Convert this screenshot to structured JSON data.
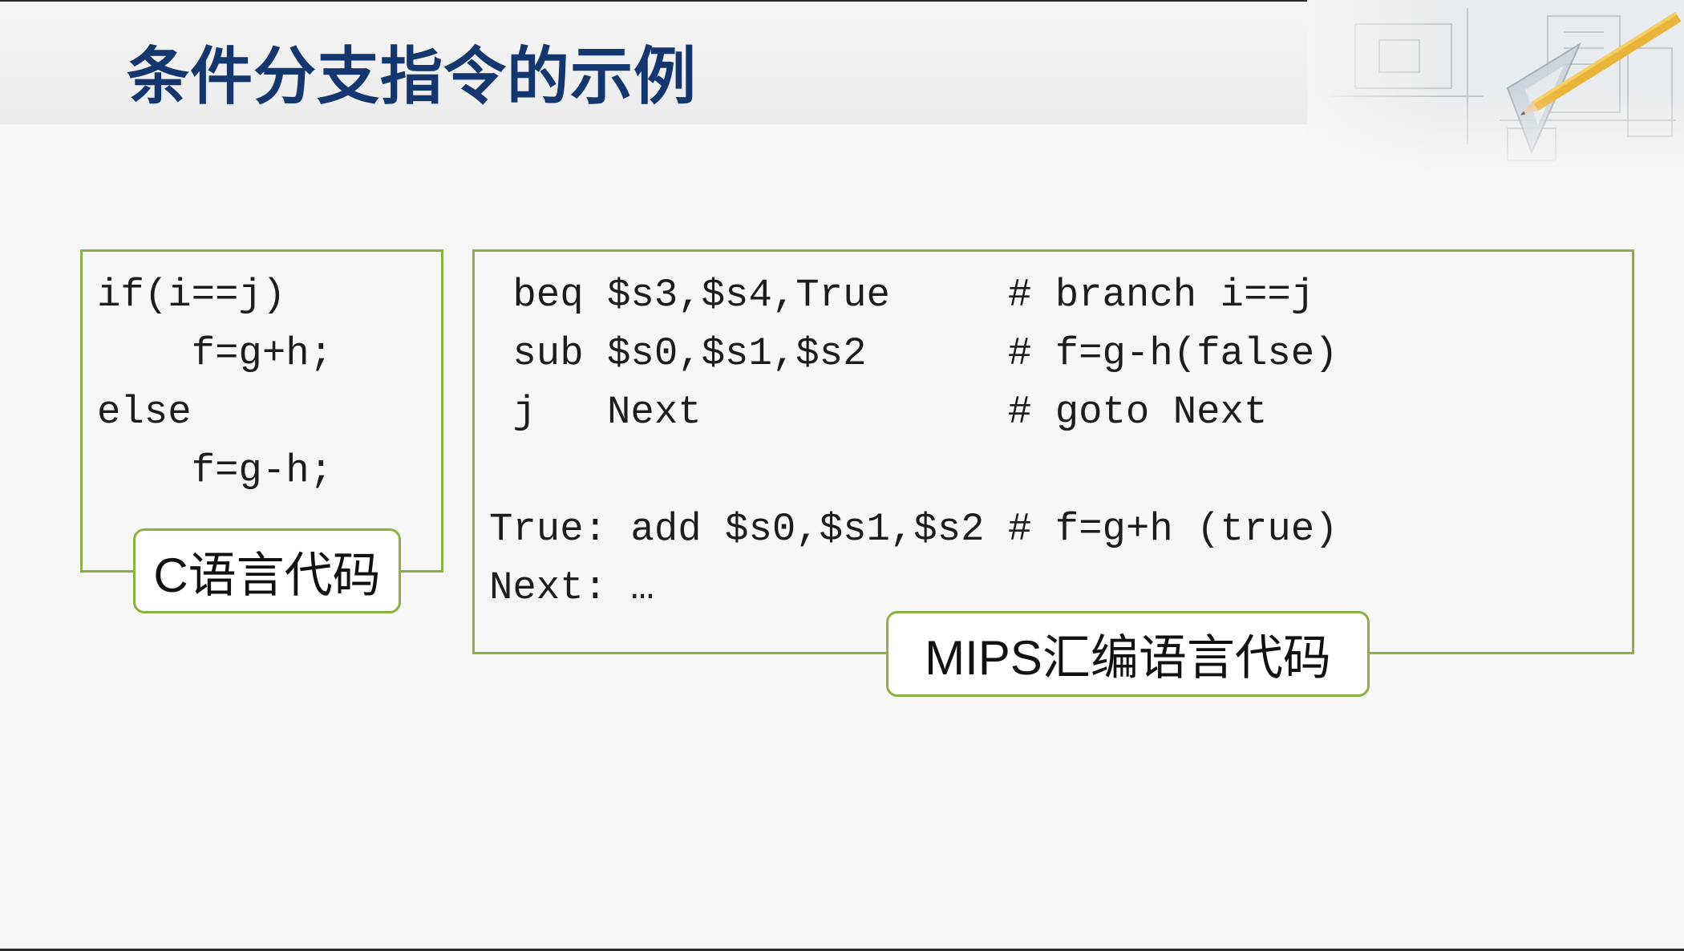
{
  "slide": {
    "title": "条件分支指令的示例"
  },
  "c_code": {
    "lines": [
      "if(i==j)",
      "    f=g+h;",
      "else",
      "    f=g-h;"
    ],
    "label": "C语言代码"
  },
  "mips_code": {
    "lines": [
      " beq $s3,$s4,True     # branch i==j",
      " sub $s0,$s1,$s2      # f=g-h(false)",
      " j   Next             # goto Next",
      "",
      "True: add $s0,$s1,$s2 # f=g+h (true)",
      "Next: …"
    ],
    "label": "MIPS汇编语言代码"
  },
  "colors": {
    "title": "#14366e",
    "frame": "#8cb042",
    "background": "#f7f7f7"
  },
  "decoration": {
    "icon": "drafting-pencil-ruler-icon"
  }
}
